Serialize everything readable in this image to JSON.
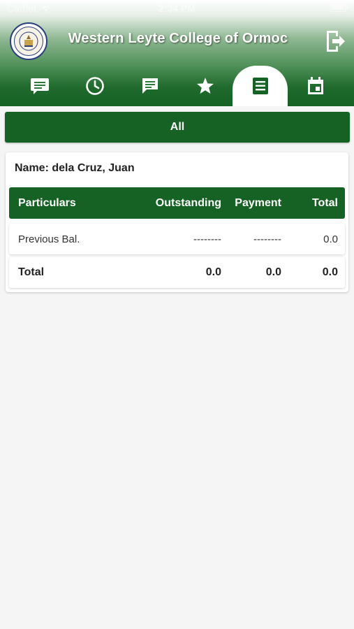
{
  "status_bar": {
    "carrier": "Carrier",
    "time": "2:34 PM"
  },
  "header": {
    "title": "Western Leyte College of Ormoc"
  },
  "tabs": [
    {
      "icon": "announcements-icon",
      "active": false
    },
    {
      "icon": "clock-icon",
      "active": false
    },
    {
      "icon": "message-icon",
      "active": false
    },
    {
      "icon": "star-icon",
      "active": false
    },
    {
      "icon": "receipt-icon",
      "active": true
    },
    {
      "icon": "calendar-icon",
      "active": false
    }
  ],
  "filter": {
    "label": "All"
  },
  "account": {
    "name_label": "Name: dela Cruz, Juan",
    "columns": {
      "particulars": "Particulars",
      "outstanding": "Outstanding",
      "payment": "Payment",
      "total": "Total"
    },
    "rows": [
      {
        "particulars": "Previous Bal.",
        "outstanding": "--------",
        "payment": "--------",
        "total": "0.0"
      }
    ],
    "totals": {
      "label": "Total",
      "outstanding": "0.0",
      "payment": "0.0",
      "total": "0.0"
    }
  },
  "colors": {
    "primary_green": "#156224",
    "header_gradient_top": "#ffffff",
    "background": "#f5f5f5"
  }
}
